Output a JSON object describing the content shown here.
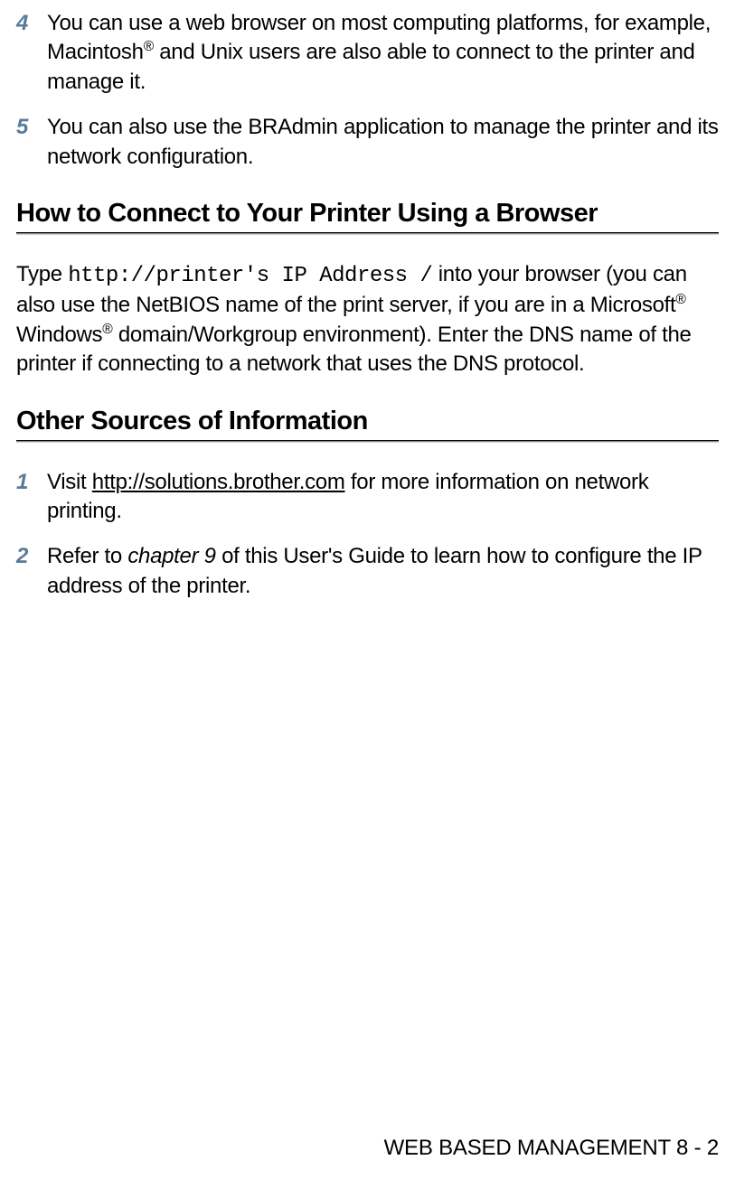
{
  "list1": {
    "item4": {
      "num": "4",
      "text_a": "You can use a web browser on most computing platforms, for example, Macintosh",
      "reg1": "®",
      "text_b": " and Unix users are also able to connect to the printer and manage it."
    },
    "item5": {
      "num": "5",
      "text": "You can also use the BRAdmin application to manage the printer and its network configuration."
    }
  },
  "heading1": "How to Connect to Your Printer Using a Browser",
  "para1": {
    "a": "Type ",
    "mono": "http://printer's IP Address /",
    "b": " into your browser (you can also use the NetBIOS name of the print server, if you are in a Microsoft",
    "reg1": "®",
    "c": " Windows",
    "reg2": "®",
    "d": " domain/Workgroup environment). Enter the DNS name of the printer if connecting to a network that uses the DNS protocol."
  },
  "heading2": "Other Sources of Information",
  "list2": {
    "item1": {
      "num": "1",
      "text_a": "Visit ",
      "url": "http://solutions.brother.com",
      "text_b": " for more information on network printing."
    },
    "item2": {
      "num": "2",
      "text_a": "Refer to ",
      "chapter": "chapter 9",
      "text_b": " of this User's Guide to learn how to configure the IP address of the printer."
    }
  },
  "footer": "WEB BASED MANAGEMENT 8 - 2"
}
